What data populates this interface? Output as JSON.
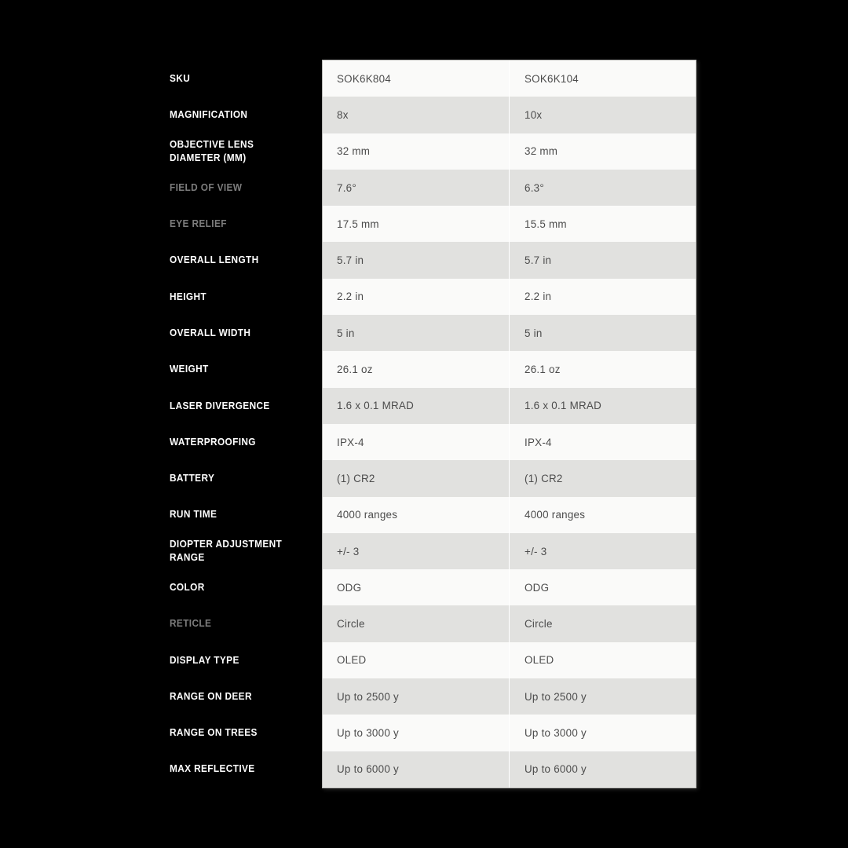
{
  "page": {
    "background_color": "#000000",
    "panel_color": "#fafaf9",
    "panel_alt_color": "#e1e1df",
    "label_color": "#ffffff",
    "label_dim_color": "#7d7d7d",
    "value_color": "#4c4c4c"
  },
  "table": {
    "column_count": 2,
    "rows": [
      {
        "label": "SKU",
        "dim": false,
        "values": [
          "SOK6K804",
          "SOK6K104"
        ]
      },
      {
        "label": "MAGNIFICATION",
        "dim": false,
        "values": [
          "8x",
          "10x"
        ]
      },
      {
        "label": "OBJECTIVE LENS DIAMETER (MM)",
        "dim": false,
        "values": [
          "32 mm",
          "32 mm"
        ]
      },
      {
        "label": "FIELD OF VIEW",
        "dim": true,
        "values": [
          "7.6°",
          "6.3°"
        ]
      },
      {
        "label": "EYE RELIEF",
        "dim": true,
        "values": [
          "17.5 mm",
          "15.5 mm"
        ]
      },
      {
        "label": "OVERALL LENGTH",
        "dim": false,
        "values": [
          "5.7 in",
          "5.7 in"
        ]
      },
      {
        "label": "HEIGHT",
        "dim": false,
        "values": [
          "2.2 in",
          "2.2 in"
        ]
      },
      {
        "label": "OVERALL WIDTH",
        "dim": false,
        "values": [
          "5 in",
          "5 in"
        ]
      },
      {
        "label": "WEIGHT",
        "dim": false,
        "values": [
          "26.1 oz",
          "26.1 oz"
        ]
      },
      {
        "label": "LASER DIVERGENCE",
        "dim": false,
        "values": [
          "1.6 x 0.1 MRAD",
          "1.6 x 0.1 MRAD"
        ]
      },
      {
        "label": "WATERPROOFING",
        "dim": false,
        "values": [
          "IPX-4",
          "IPX-4"
        ]
      },
      {
        "label": "BATTERY",
        "dim": false,
        "values": [
          "(1) CR2",
          "(1) CR2"
        ]
      },
      {
        "label": "RUN TIME",
        "dim": false,
        "values": [
          "4000 ranges",
          "4000 ranges"
        ]
      },
      {
        "label": "DIOPTER ADJUSTMENT RANGE",
        "dim": false,
        "values": [
          "+/- 3",
          "+/- 3"
        ]
      },
      {
        "label": "COLOR",
        "dim": false,
        "values": [
          "ODG",
          "ODG"
        ]
      },
      {
        "label": "RETICLE",
        "dim": true,
        "values": [
          "Circle",
          "Circle"
        ]
      },
      {
        "label": "DISPLAY TYPE",
        "dim": false,
        "values": [
          "OLED",
          "OLED"
        ]
      },
      {
        "label": "RANGE ON DEER",
        "dim": false,
        "values": [
          "Up to 2500 y",
          "Up to 2500 y"
        ]
      },
      {
        "label": "RANGE ON TREES",
        "dim": false,
        "values": [
          "Up to 3000 y",
          "Up to 3000 y"
        ]
      },
      {
        "label": "MAX REFLECTIVE",
        "dim": false,
        "values": [
          "Up to 6000 y",
          "Up to 6000 y"
        ]
      }
    ]
  }
}
